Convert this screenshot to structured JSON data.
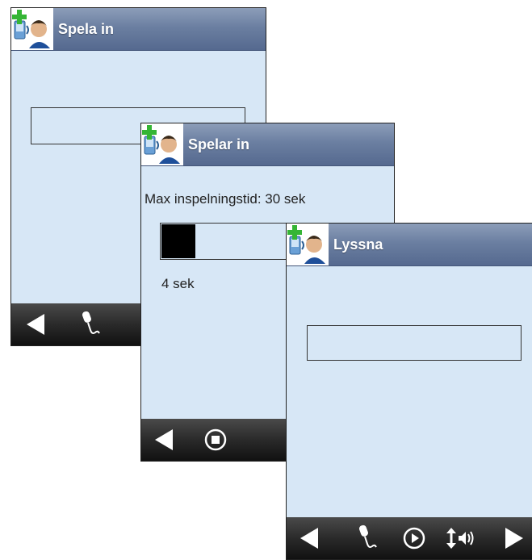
{
  "screens": [
    {
      "title": "Spela in",
      "toolbar": [
        "back-icon",
        "microphone-icon"
      ]
    },
    {
      "title": "Spelar in",
      "max_time_label": "Max inspelningstid: 30 sek",
      "progress": 0.16,
      "elapsed_label": "4 sek",
      "toolbar": [
        "back-icon",
        "stop-icon"
      ]
    },
    {
      "title": "Lyssna",
      "toolbar": [
        "back-icon",
        "microphone-icon",
        "play-icon",
        "volume-icon",
        "forward-icon"
      ]
    }
  ],
  "colors": {
    "screen_bg": "#d7e7f6",
    "titlebar": "#6b7fa1",
    "toolbar": "#2a2a2a",
    "progress_fill": "#000000"
  }
}
